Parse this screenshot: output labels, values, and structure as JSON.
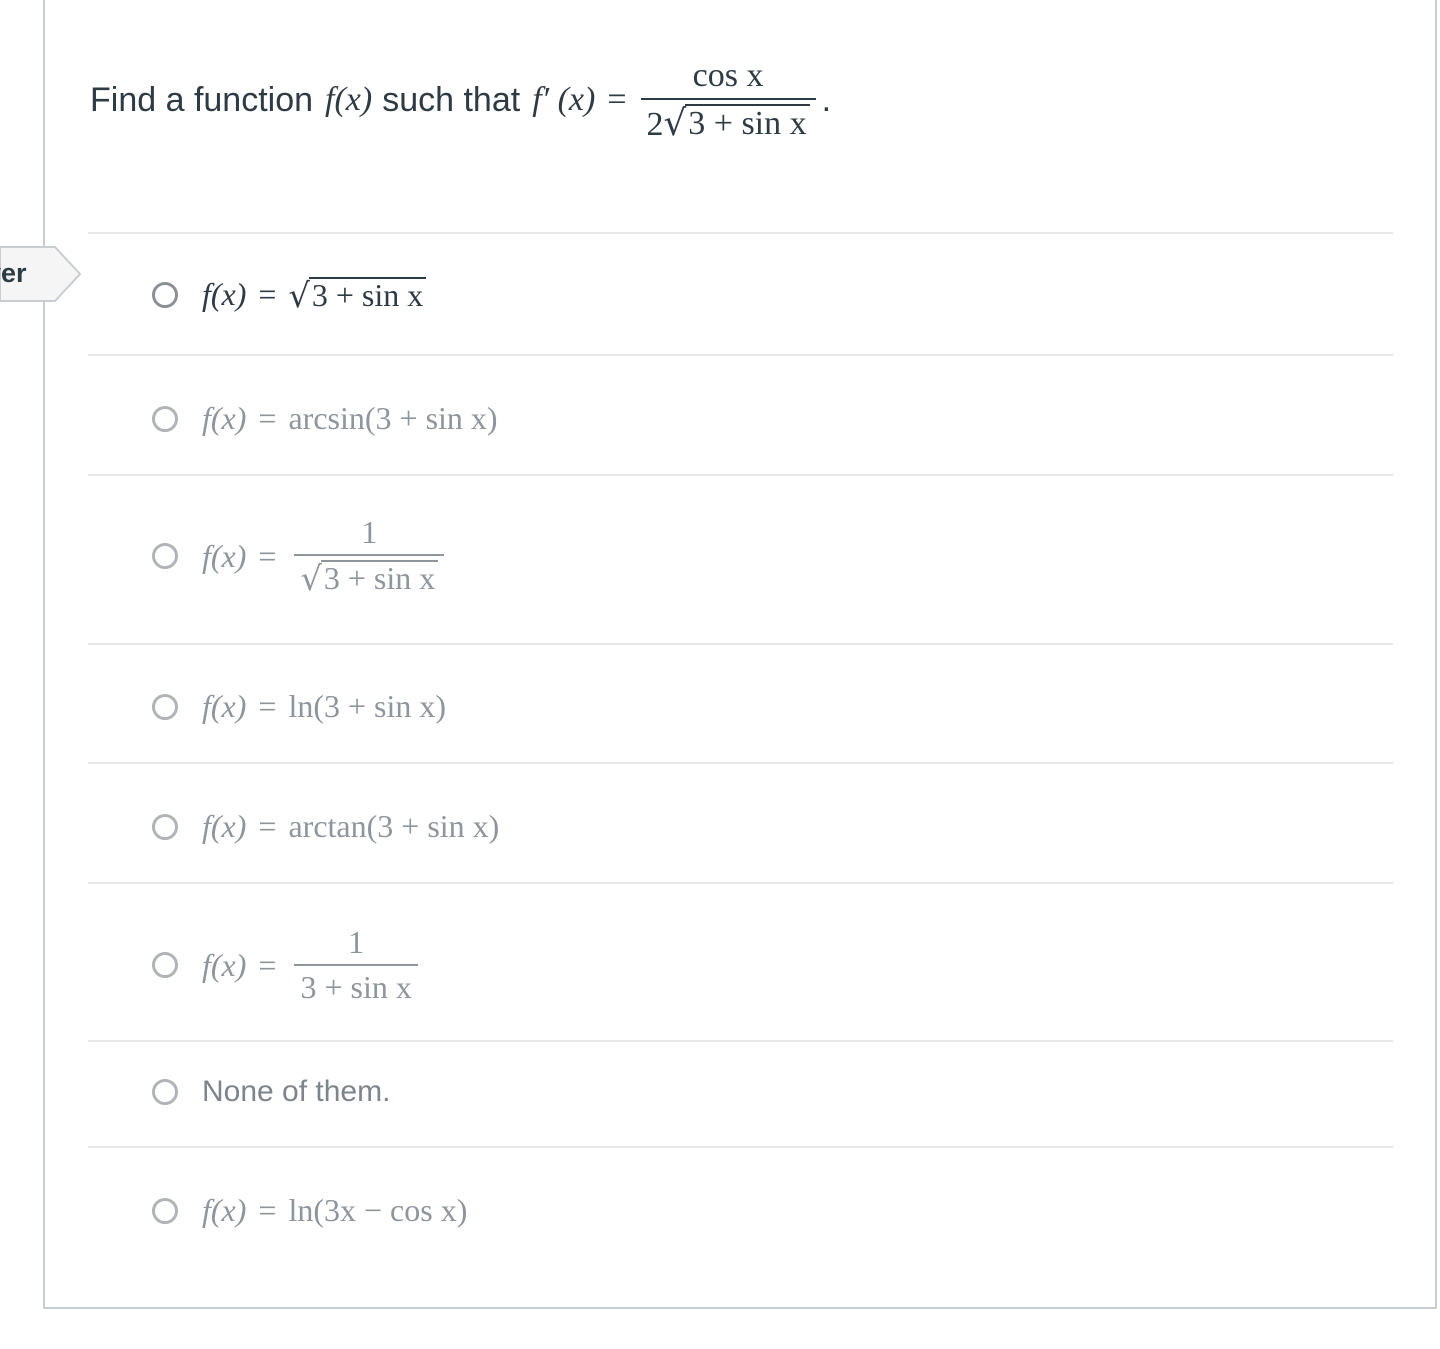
{
  "tab": {
    "label": "ver"
  },
  "question": {
    "prefix": "Find a function",
    "f_of_x": "f(x)",
    "middle": "such that",
    "fprime": "f′ (x)",
    "equals": "=",
    "numerator": "cos x",
    "den_coef": "2",
    "den_radicand": "3 + sin x",
    "period": "."
  },
  "options": [
    {
      "lhs": "f(x)",
      "eq": "=",
      "radicand": "3 + sin x"
    },
    {
      "lhs": "f(x)",
      "eq": "=",
      "rhs": "arcsin(3 + sin x)"
    },
    {
      "lhs": "f(x)",
      "eq": "=",
      "numerator": "1",
      "radicand": "3 + sin x"
    },
    {
      "lhs": "f(x)",
      "eq": "=",
      "rhs": "ln(3 + sin x)"
    },
    {
      "lhs": "f(x)",
      "eq": "=",
      "rhs": "arctan(3 + sin x)"
    },
    {
      "lhs": "f(x)",
      "eq": "=",
      "numerator": "1",
      "denominator": "3 + sin x"
    },
    {
      "text": "None of them."
    },
    {
      "lhs": "f(x)",
      "eq": "=",
      "rhs": "ln(3x − cos x)"
    }
  ]
}
